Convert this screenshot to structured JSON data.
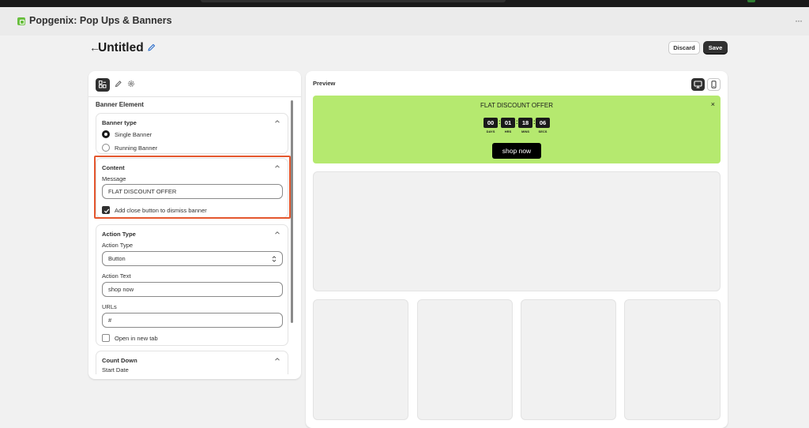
{
  "app": {
    "title": "Popgenix: Pop Ups & Banners",
    "more_label": "···"
  },
  "page": {
    "back_arrow": "←",
    "title": "Untitled"
  },
  "actions": {
    "discard_label": "Discard",
    "save_label": "Save"
  },
  "editor": {
    "section_heading": "Banner Element",
    "banner_type": {
      "title": "Banner type",
      "options": [
        {
          "label": "Single Banner",
          "checked": true
        },
        {
          "label": "Running Banner",
          "checked": false
        }
      ]
    },
    "content": {
      "title": "Content",
      "message_label": "Message",
      "message_value": "FLAT DISCOUNT OFFER",
      "close_button_label": "Add close button to dismiss banner",
      "close_button_checked": true
    },
    "action": {
      "title": "Action Type",
      "type_label": "Action Type",
      "type_value": "Button",
      "text_label": "Action Text",
      "text_value": "shop now",
      "url_label": "URLs",
      "url_value": "#",
      "new_tab_label": "Open in new tab",
      "new_tab_checked": false
    },
    "countdown": {
      "title": "Count Down",
      "start_date_label": "Start Date"
    }
  },
  "preview": {
    "label": "Preview",
    "banner": {
      "message": "FLAT DISCOUNT OFFER",
      "close_glyph": "×",
      "countdown": [
        {
          "value": "00",
          "unit": "DAYS"
        },
        {
          "value": "01",
          "unit": "HRS"
        },
        {
          "value": "18",
          "unit": "MINS"
        },
        {
          "value": "06",
          "unit": "SECS"
        }
      ],
      "separator": ":",
      "button_label": "shop now",
      "background": "#b5e96f"
    }
  },
  "icons": {
    "app_logo": "app-logo-icon",
    "edit_title": "pencil-icon",
    "layout_tool": "layout-icon",
    "style_tool": "pencil-icon",
    "settings_tool": "gear-icon",
    "desktop_view": "desktop-icon",
    "mobile_view": "mobile-icon",
    "chevron": "chevron-up-icon",
    "select": "select-arrows-icon"
  },
  "colors": {
    "accent": "#303030",
    "highlight": "#e4572e",
    "banner": "#b5e96f"
  }
}
